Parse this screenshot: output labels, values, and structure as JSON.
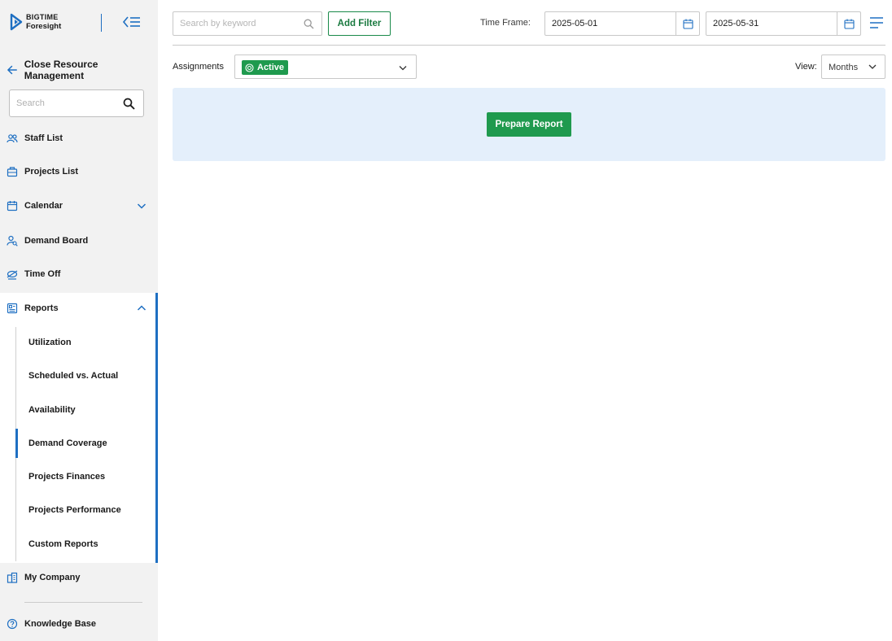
{
  "brand": {
    "line1": "BIGTIME",
    "line2": "Foresight"
  },
  "sidebar": {
    "back_label": "Close Resource Management",
    "search_placeholder": "Search",
    "items": [
      {
        "label": "Staff List",
        "icon": "users-icon"
      },
      {
        "label": "Projects List",
        "icon": "briefcase-icon"
      },
      {
        "label": "Calendar",
        "icon": "calendar-icon",
        "expandable": true,
        "expanded": false
      },
      {
        "label": "Demand Board",
        "icon": "person-search-icon"
      },
      {
        "label": "Time Off",
        "icon": "plane-icon"
      },
      {
        "label": "Reports",
        "icon": "report-icon",
        "expandable": true,
        "expanded": true
      }
    ],
    "reports_sub": [
      {
        "label": "Utilization"
      },
      {
        "label": "Scheduled vs. Actual"
      },
      {
        "label": "Availability"
      },
      {
        "label": "Demand Coverage",
        "active": true
      },
      {
        "label": "Projects Finances"
      },
      {
        "label": "Projects Performance"
      },
      {
        "label": "Custom Reports"
      }
    ],
    "my_company": "My Company",
    "knowledge_base": "Knowledge Base"
  },
  "toolbar": {
    "keyword_placeholder": "Search by keyword",
    "add_filter": "Add Filter",
    "time_frame_label": "Time Frame:",
    "start_date": "2025-05-01",
    "end_date": "2025-05-31"
  },
  "filters": {
    "assignments_label": "Assignments",
    "assignments_chip": "Active",
    "view_label": "View:",
    "view_value": "Months"
  },
  "report": {
    "prepare_button": "Prepare Report"
  },
  "colors": {
    "accent_blue": "#1e6fc2",
    "green": "#1f9a4e",
    "panel_bg": "#e4effb",
    "sidebar_bg": "#f2f2f2"
  }
}
